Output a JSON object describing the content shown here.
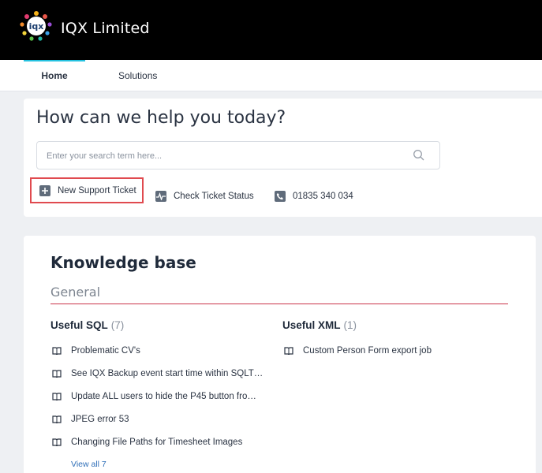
{
  "header": {
    "brand": "IQX Limited"
  },
  "nav": {
    "tabs": [
      "Home",
      "Solutions"
    ]
  },
  "help": {
    "title": "How can we help you today?",
    "search_placeholder": "Enter your search term here...",
    "actions": {
      "new_ticket": "New Support Ticket",
      "check_status": "Check Ticket Status",
      "phone": "01835 340 034"
    }
  },
  "kb": {
    "title": "Knowledge base",
    "section": "General",
    "categories": [
      {
        "name": "Useful SQL",
        "count": "(7)",
        "articles": [
          "Problematic CV's",
          "See IQX Backup event start time within SQLT…",
          "Update ALL users to hide the P45 button fro…",
          "JPEG error 53",
          "Changing File Paths for Timesheet Images"
        ],
        "view_all": "View all 7"
      },
      {
        "name": "Useful XML",
        "count": "(1)",
        "articles": [
          "Custom Person Form export job"
        ]
      }
    ]
  },
  "colors": {
    "accent": "#25c2e0",
    "highlight": "#e04a4f",
    "rule": "#c9334a",
    "link": "#2f6fb8"
  },
  "icons": {
    "new_ticket": "plus-box-icon",
    "check_status": "pulse-icon",
    "phone": "phone-icon",
    "article": "book-icon",
    "search": "search-icon"
  }
}
